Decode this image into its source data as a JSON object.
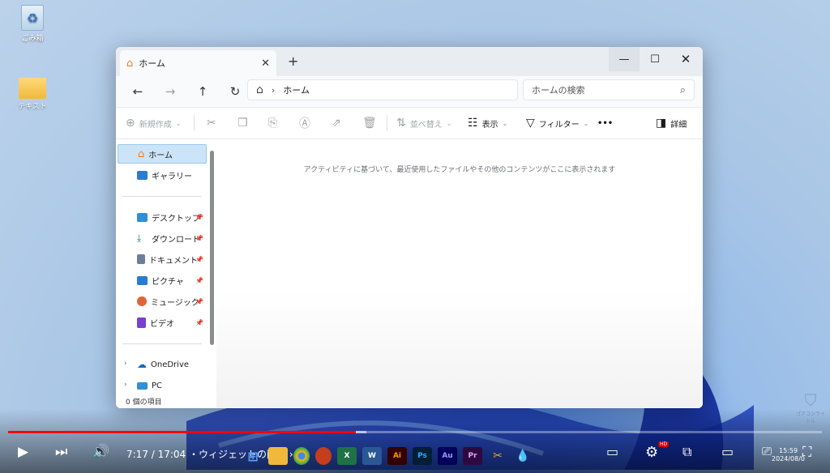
{
  "desktop": {
    "icons": [
      {
        "label": "ごみ箱",
        "icon": "recycle-bin-icon"
      },
      {
        "label": "テキスト",
        "icon": "folder-icon"
      }
    ]
  },
  "window": {
    "tab_title": "ホーム",
    "tab_close": "✕",
    "new_tab": "+",
    "controls": {
      "minimize": "—",
      "maximize": "☐",
      "close": "✕"
    },
    "nav": {
      "back": "←",
      "forward": "→",
      "up": "↑",
      "refresh": "↻"
    },
    "address": {
      "home_glyph": "⌂",
      "separator": "›",
      "path": "ホーム"
    },
    "search": {
      "placeholder": "ホームの検索",
      "icon": "⌕"
    },
    "commands": {
      "new": "新規作成",
      "sort": "並べ替え",
      "view": "表示",
      "filter": "フィルター",
      "more": "•••",
      "details": "詳細"
    },
    "sidebar": {
      "home": "ホーム",
      "gallery": "ギャラリー",
      "quick": [
        {
          "label": "デスクトップ",
          "color": "#2f8fd8"
        },
        {
          "label": "ダウンロード",
          "color": "#1a8a5a"
        },
        {
          "label": "ドキュメント",
          "color": "#6d7f96"
        },
        {
          "label": "ピクチャ",
          "color": "#2a7cd1"
        },
        {
          "label": "ミュージック",
          "color": "#e0643a"
        },
        {
          "label": "ビデオ",
          "color": "#7a3fd0"
        }
      ],
      "onedrive": "OneDrive",
      "pc": "PC"
    },
    "empty_message": "アクティビティに基づいて、最近使用したファイルやその他のコンテンツがここに表示されます",
    "status": "0 個の項目"
  },
  "player": {
    "time": "7:17 / 17:04",
    "chapter": "・ウィジェットの削除",
    "chapter_chevron": "›",
    "progress_played": 0.427,
    "progress_buffered": 0.44,
    "hd_badge": "HD",
    "accent": "#ff0000"
  },
  "taskbar": {
    "apps": [
      {
        "label": "W",
        "color": "#2b5797",
        "name": "word-icon"
      },
      {
        "label": "X",
        "color": "#1f7244",
        "name": "excel-icon"
      },
      {
        "label": "P",
        "color": "#c43e1c",
        "name": "powerpoint-icon"
      },
      {
        "label": "Ai",
        "color": "#330000",
        "name": "illustrator-icon"
      },
      {
        "label": "Ps",
        "color": "#001e36",
        "name": "photoshop-icon"
      },
      {
        "label": "Au",
        "color": "#00005b",
        "name": "audition-icon"
      },
      {
        "label": "Pr",
        "color": "#2d0a3d",
        "name": "premiere-icon"
      }
    ],
    "clock_time": "15:59",
    "clock_date": "2024/08/0"
  },
  "watermark": "ゴアコンライトル"
}
